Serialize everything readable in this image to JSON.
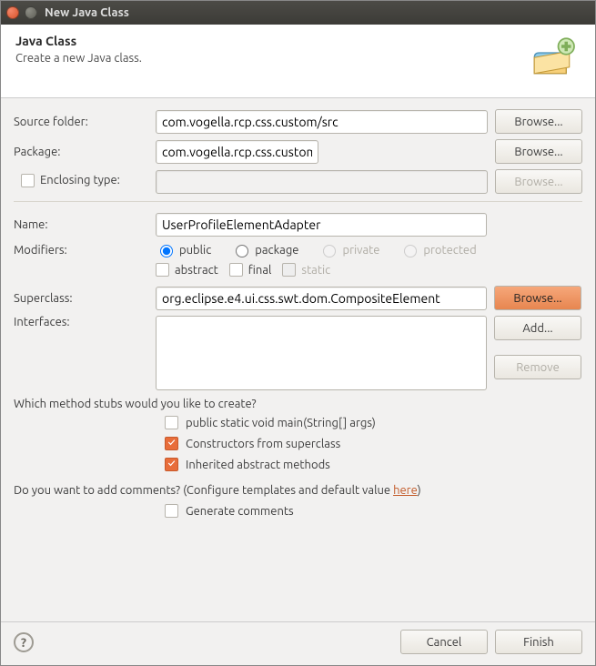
{
  "titlebar": {
    "title": "New Java Class"
  },
  "header": {
    "title": "Java Class",
    "subtitle": "Create a new Java class."
  },
  "labels": {
    "sourceFolder": "Source folder:",
    "package": "Package:",
    "enclosingType": "Enclosing type:",
    "name": "Name:",
    "modifiers": "Modifiers:",
    "superclass": "Superclass:",
    "interfaces": "Interfaces:"
  },
  "values": {
    "sourceFolder": "com.vogella.rcp.css.custom/src",
    "package": "com.vogella.rcp.css.custom.css",
    "enclosingType": "",
    "name": "UserProfileElementAdapter",
    "superclass": "org.eclipse.e4.ui.css.swt.dom.CompositeElement"
  },
  "buttons": {
    "browse": "Browse...",
    "add": "Add...",
    "remove": "Remove",
    "cancel": "Cancel",
    "finish": "Finish"
  },
  "modifiers": {
    "public": "public",
    "package": "package",
    "private": "private",
    "protected": "protected",
    "abstract": "abstract",
    "final": "final",
    "static": "static"
  },
  "stubs": {
    "question": "Which method stubs would you like to create?",
    "main": "public static void main(String[] args)",
    "constructors": "Constructors from superclass",
    "inherited": "Inherited abstract methods"
  },
  "comments": {
    "question_pre": "Do you want to add comments? (Configure templates and default value ",
    "link": "here",
    "question_post": ")",
    "generate": "Generate comments"
  }
}
